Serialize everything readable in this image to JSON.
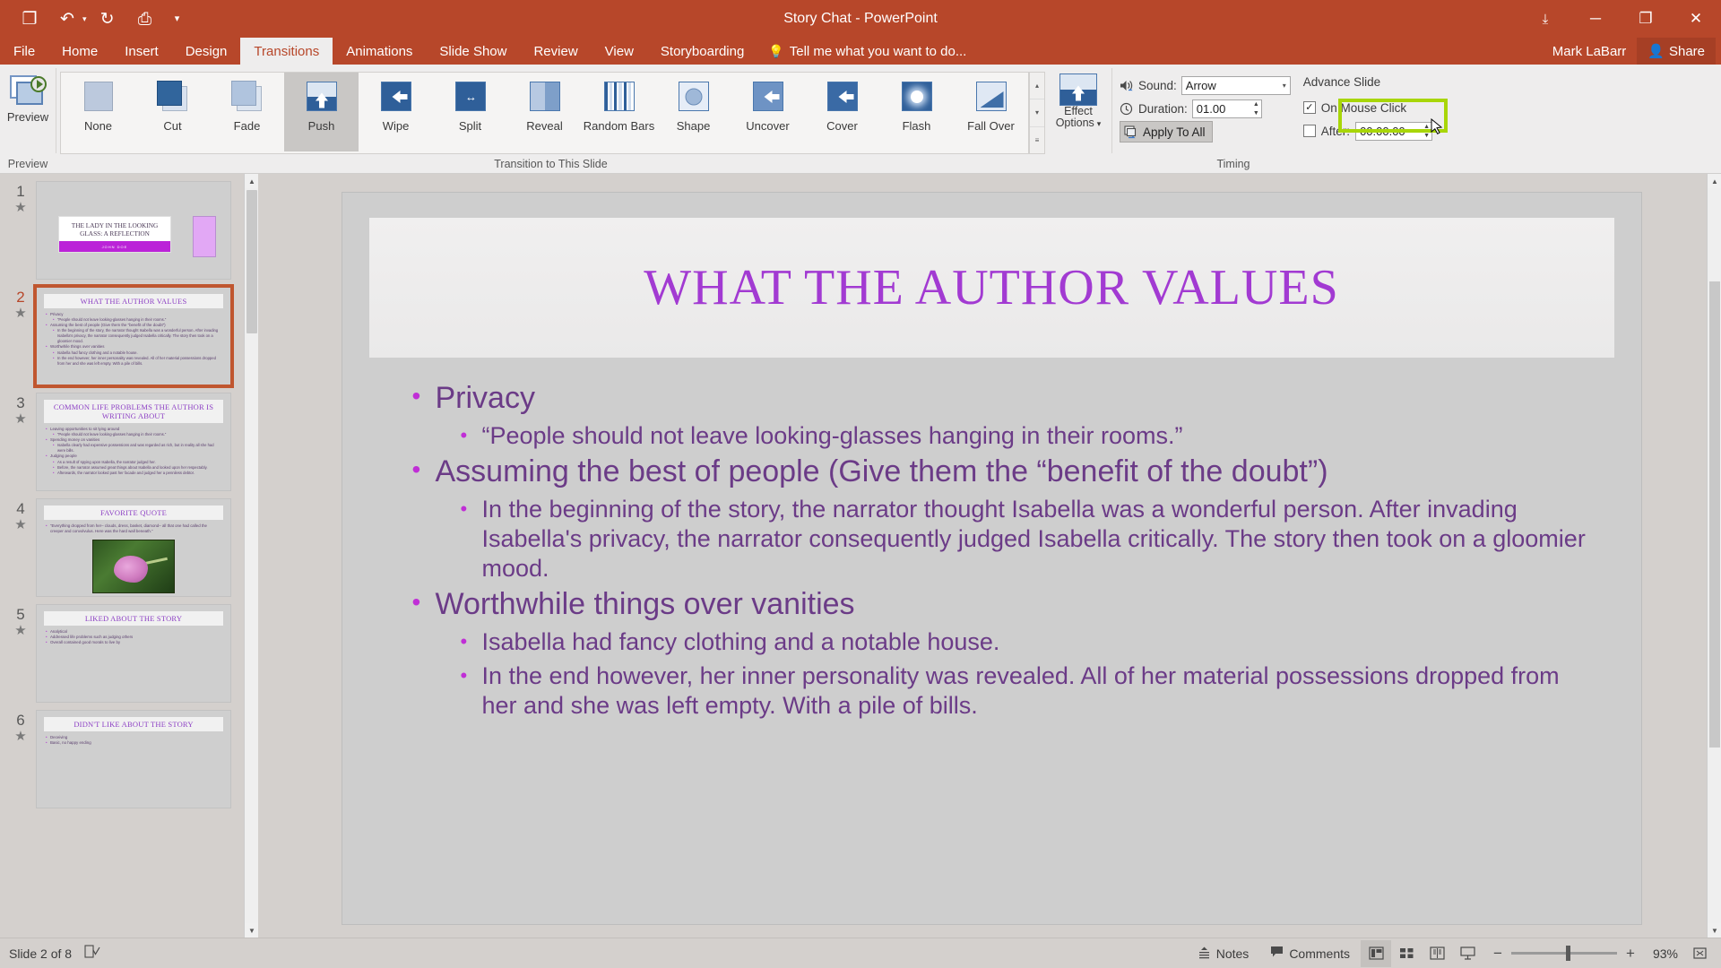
{
  "titlebar": {
    "title": "Story Chat - PowerPoint",
    "qat": [
      {
        "name": "save-icon",
        "glyph": "❐"
      },
      {
        "name": "undo-icon",
        "glyph": "↶"
      },
      {
        "name": "redo-icon",
        "glyph": "↻"
      },
      {
        "name": "start-presentation-icon",
        "glyph": "⎙"
      },
      {
        "name": "customize-qat-icon",
        "glyph": "▾"
      }
    ],
    "window_controls": [
      {
        "name": "ribbon-display-options-icon",
        "glyph": "⤓"
      },
      {
        "name": "minimize-icon",
        "glyph": "─"
      },
      {
        "name": "restore-icon",
        "glyph": "❐"
      },
      {
        "name": "close-icon",
        "glyph": "✕"
      }
    ]
  },
  "tabs": [
    {
      "label": "File",
      "active": false
    },
    {
      "label": "Home",
      "active": false
    },
    {
      "label": "Insert",
      "active": false
    },
    {
      "label": "Design",
      "active": false
    },
    {
      "label": "Transitions",
      "active": true
    },
    {
      "label": "Animations",
      "active": false
    },
    {
      "label": "Slide Show",
      "active": false
    },
    {
      "label": "Review",
      "active": false
    },
    {
      "label": "View",
      "active": false
    },
    {
      "label": "Storyboarding",
      "active": false
    }
  ],
  "tellme": {
    "placeholder": "Tell me what you want to do...",
    "icon": "lightbulb-icon"
  },
  "account": {
    "user": "Mark LaBarr",
    "share_label": "Share",
    "share_icon": "person-add-icon"
  },
  "ribbon": {
    "preview": {
      "button_label": "Preview",
      "group_label": "Preview"
    },
    "transitions": {
      "group_label": "Transition to This Slide",
      "items": [
        {
          "label": "None",
          "selected": false
        },
        {
          "label": "Cut",
          "selected": false
        },
        {
          "label": "Fade",
          "selected": false
        },
        {
          "label": "Push",
          "selected": true
        },
        {
          "label": "Wipe",
          "selected": false
        },
        {
          "label": "Split",
          "selected": false
        },
        {
          "label": "Reveal",
          "selected": false
        },
        {
          "label": "Random Bars",
          "selected": false
        },
        {
          "label": "Shape",
          "selected": false
        },
        {
          "label": "Uncover",
          "selected": false
        },
        {
          "label": "Cover",
          "selected": false
        },
        {
          "label": "Flash",
          "selected": false
        },
        {
          "label": "Fall Over",
          "selected": false
        }
      ],
      "scroll": {
        "up": "▴",
        "down": "▾",
        "more": "≡"
      }
    },
    "effect_options": {
      "label_line1": "Effect",
      "label_line2": "Options",
      "dropdown_arrow": "▾"
    },
    "timing": {
      "group_label": "Timing",
      "sound_label": "Sound:",
      "sound_value": "Arrow",
      "duration_label": "Duration:",
      "duration_value": "01.00",
      "apply_to_all_label": "Apply To All",
      "advance_slide_title": "Advance Slide",
      "on_mouse_click_label": "On Mouse Click",
      "on_mouse_click_checked": true,
      "after_label": "After:",
      "after_value": "00:00.00",
      "after_checked": false,
      "highlight_color": "#a8d608"
    }
  },
  "thumbnails": [
    {
      "number": "1",
      "type": "title",
      "title": "THE LADY IN THE LOOKING GLASS: A REFLECTION",
      "subtitle": "JOHN DOE",
      "selected": false
    },
    {
      "number": "2",
      "type": "content",
      "title": "WHAT THE AUTHOR VALUES",
      "selected": true,
      "lines": [
        {
          "level": 1,
          "text": "Privacy"
        },
        {
          "level": 2,
          "text": "“People should not leave looking-glasses hanging in their rooms.”"
        },
        {
          "level": 1,
          "text": "Assuming the best of people (Give them the “benefit of the doubt”)"
        },
        {
          "level": 2,
          "text": "In the beginning of the story, the narrator thought Isabella was a wonderful person. After invading Isabella's privacy, the narrator consequently judged Isabella critically. The story then took on a gloomier mood."
        },
        {
          "level": 1,
          "text": "Worthwhile things over vanities"
        },
        {
          "level": 2,
          "text": "Isabella had fancy clothing and a notable house."
        },
        {
          "level": 2,
          "text": "In the end however, her inner personality was revealed. All of her material possessions dropped from her and she was left empty. With a pile of bills."
        }
      ]
    },
    {
      "number": "3",
      "type": "content",
      "title": "COMMON LIFE PROBLEMS THE AUTHOR IS WRITING ABOUT",
      "selected": false,
      "lines": [
        {
          "level": 1,
          "text": "Leaving opportunities to sit lying around"
        },
        {
          "level": 2,
          "text": "“People should not leave looking-glasses hanging in their rooms.”"
        },
        {
          "level": 1,
          "text": "Spending money on vanities"
        },
        {
          "level": 2,
          "text": "Isabella clearly had expensive possessions and was regarded as rich, but in reality all she had were bills."
        },
        {
          "level": 1,
          "text": "Judging people"
        },
        {
          "level": 2,
          "text": "As a result of spying upon Isabella, the narrator judged her."
        },
        {
          "level": 2,
          "text": "Before, the narrator assumed great things about Isabella and looked upon her respectably."
        },
        {
          "level": 2,
          "text": "Afterwards, the narrator looked past her facade and judged her a penniless debtor."
        }
      ]
    },
    {
      "number": "4",
      "type": "quote",
      "title": "FAVORITE QUOTE",
      "selected": false,
      "lines": [
        {
          "level": 1,
          "text": "“Everything dropped from her– clouds, dress, basket, diamond– all that one had called the creeper and convolvulus. Here was the hard wall beneath.”"
        }
      ]
    },
    {
      "number": "5",
      "type": "content",
      "title": "LIKED ABOUT THE STORY",
      "selected": false,
      "lines": [
        {
          "level": 1,
          "text": "Analytical"
        },
        {
          "level": 1,
          "text": "Addressed life problems such as judging others"
        },
        {
          "level": 1,
          "text": "Overall contained good morals to live by"
        }
      ]
    },
    {
      "number": "6",
      "type": "content",
      "title": "DIDN'T LIKE ABOUT THE STORY",
      "selected": false,
      "lines": [
        {
          "level": 1,
          "text": "Deceiving"
        },
        {
          "level": 1,
          "text": "Basic, no happy ending"
        }
      ]
    }
  ],
  "slide": {
    "title": "WHAT THE AUTHOR VALUES",
    "bullets": [
      {
        "level": 1,
        "text": "Privacy"
      },
      {
        "level": 2,
        "text": "“People should not leave looking-glasses hanging in their rooms.”"
      },
      {
        "level": 1,
        "text": "Assuming the best of people (Give them the “benefit of the doubt”)"
      },
      {
        "level": 2,
        "text": "In the beginning of the story, the narrator thought Isabella was a wonderful person. After invading Isabella's privacy, the narrator consequently judged Isabella critically. The story then took on a gloomier mood."
      },
      {
        "level": 1,
        "text": "Worthwhile things over vanities"
      },
      {
        "level": 2,
        "text": "Isabella had fancy clothing and a notable house."
      },
      {
        "level": 2,
        "text": "In the end however, her inner personality was revealed. All of her material possessions dropped from her and she was left empty. With a pile of bills."
      }
    ]
  },
  "statusbar": {
    "slide_indicator": "Slide 2 of 8",
    "accessibility_icon": "accessibility-checker-icon",
    "notes_label": "Notes",
    "comments_label": "Comments",
    "views": [
      {
        "name": "normal-view-icon",
        "active": true
      },
      {
        "name": "slide-sorter-view-icon",
        "active": false
      },
      {
        "name": "reading-view-icon",
        "active": false
      },
      {
        "name": "slide-show-view-icon",
        "active": false
      }
    ],
    "zoom_out": "−",
    "zoom_in": "+",
    "zoom_level": "93%",
    "fit_icon": "fit-slide-to-window-icon"
  }
}
